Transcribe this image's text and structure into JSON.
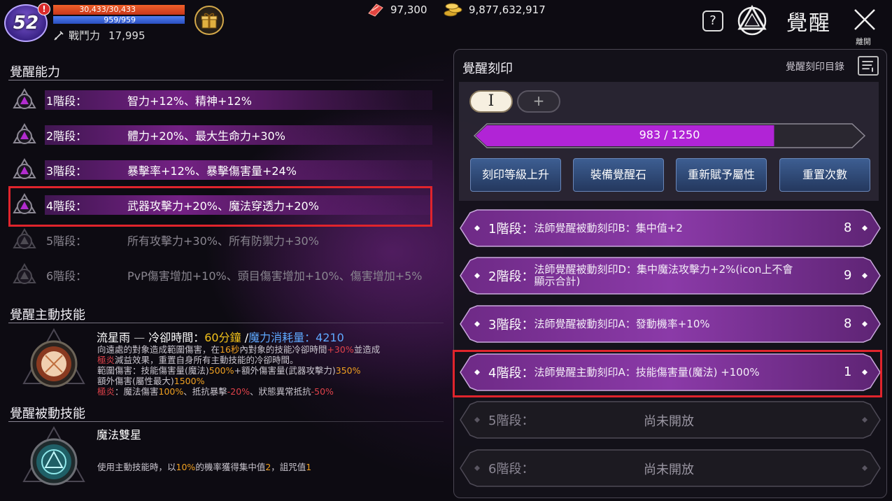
{
  "hud": {
    "level": "52",
    "alert": "!",
    "hp": "30,433/30,433",
    "mp": "959/959",
    "combat_label": "戰鬥力",
    "combat_value": "17,995",
    "crystal": "97,300",
    "gold": "9,877,632,917",
    "help": "?",
    "title": "覺醒",
    "close_label": "離開"
  },
  "left": {
    "ability_title": "覺醒能力",
    "stages": [
      {
        "name": "1階段：",
        "effect": "智力+12%、精神+12%",
        "unlocked": true
      },
      {
        "name": "2階段：",
        "effect": "體力+20%、最大生命力+30%",
        "unlocked": true
      },
      {
        "name": "3階段：",
        "effect": "暴擊率+12%、暴擊傷害量+24%",
        "unlocked": true
      },
      {
        "name": "4階段：",
        "effect": "武器攻擊力+20%、魔法穿透力+20%",
        "unlocked": true
      },
      {
        "name": "5階段：",
        "effect": "所有攻擊力+30%、所有防禦力+30%",
        "unlocked": false
      },
      {
        "name": "6階段：",
        "effect": "PvP傷害增加+10%、頭目傷害增加+10%、傷害增加+5%",
        "unlocked": false
      }
    ],
    "active_title": "覺醒主動技能",
    "active_skill": {
      "name": "流星雨",
      "dash": "—",
      "cd_label": "冷卻時間：",
      "cd_value": "60分鐘",
      "slash": "/",
      "mana_label": "魔力消耗量：",
      "mana_value": "4210",
      "l1a": "向遠處的對象造成範圍傷害，在",
      "l1b": "16秒",
      "l1c": "內對象的技能冷卻時間",
      "l1d": "+30%",
      "l1e": "並造成",
      "l2a": "極炎",
      "l2b": "減益效果，重置自身所有主動技能的冷卻時間。",
      "l3a": "範圍傷害：技能傷害量(魔法)",
      "l3b": "500%",
      "l3c": "+額外傷害量(武器攻擊力)",
      "l3d": "350%",
      "l4a": "額外傷害(屬性最大)",
      "l4b": "1500%",
      "l5a": "極炎",
      "l5b": "：魔法傷害",
      "l5c": "100%",
      "l5d": "、抵抗暴擊",
      "l5e": "-20%",
      "l5f": "、狀態異常抵抗",
      "l5g": "-50%"
    },
    "passive_title": "覺醒被動技能",
    "passive_skill": {
      "name": "魔法雙星",
      "d1": "使用主動技能時，以",
      "d2": "10%",
      "d3": "的機率獲得集中值",
      "d4": "2",
      "d5": "，詛咒值",
      "d6": "1"
    }
  },
  "right": {
    "title": "覺醒刻印",
    "catalog_label": "覺醒刻印目錄",
    "tab_roman": "I",
    "tab_plus": "+",
    "progress": {
      "current": 983,
      "max": 1250,
      "text": "983 / 1250"
    },
    "buttons": [
      "刻印等級上升",
      "裝備覺醒石",
      "重新賦予屬性",
      "重置次數"
    ],
    "imprints": [
      {
        "stage": "1階段：",
        "desc": "法師覺醒被動刻印B：集中值+2",
        "level": "8",
        "unlocked": true
      },
      {
        "stage": "2階段：",
        "desc": "法師覺醒被動刻印D：集中魔法攻擊力+2%(icon上不會顯示合計)",
        "level": "9",
        "unlocked": true
      },
      {
        "stage": "3階段：",
        "desc": "法師覺醒被動刻印A：發動機率+10%",
        "level": "8",
        "unlocked": true
      },
      {
        "stage": "4階段：",
        "desc": "法師覺醒主動刻印A：技能傷害量(魔法) +100%",
        "level": "1",
        "unlocked": true
      },
      {
        "stage": "5階段：",
        "desc": "尚未開放",
        "level": "",
        "unlocked": false
      },
      {
        "stage": "6階段：",
        "desc": "尚未開放",
        "level": "",
        "unlocked": false
      }
    ]
  },
  "colors": {
    "accent_purple": "#b22ccf",
    "highlight_red": "#e0242c",
    "button_blue": "#2f4a78",
    "yellow_text": "#f3c21a",
    "blue_text": "#5fa8ff"
  }
}
